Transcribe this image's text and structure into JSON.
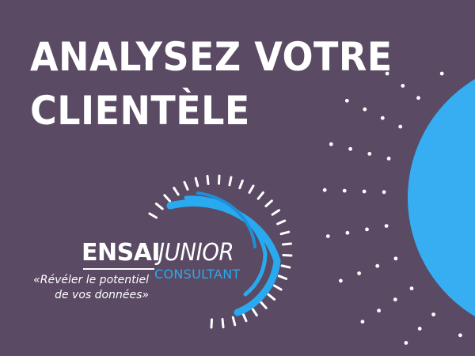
{
  "headline": {
    "line1": "ANALYSEZ VOTRE",
    "line2": "CLIENTÈLE"
  },
  "logo": {
    "ensai": "ENSAI",
    "junior": "JUNIOR",
    "consultant": "CONSULTANT",
    "tagline_line1": "«Révéler le potentiel",
    "tagline_line2": "de vos données»"
  },
  "colors": {
    "background": "#5a4a64",
    "accent_blue": "#29aaf0",
    "white": "#ffffff"
  },
  "icons": [
    "dot-pattern",
    "blue-circle",
    "logo-swoosh"
  ]
}
